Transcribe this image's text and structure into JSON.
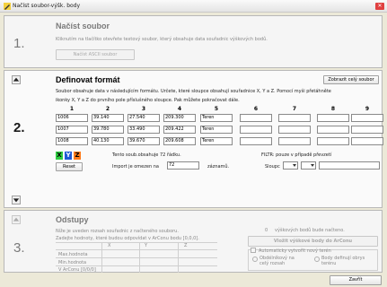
{
  "window": {
    "title": "Načíst soubor-výšk. body"
  },
  "step1": {
    "number": "1.",
    "heading": "Načíst soubor",
    "description": "Kliknutím na tlačítko otevřete textový soubor, který obsahuje data souřadnic výškových bodů.",
    "button": "Načíst ASCII soubor"
  },
  "step2": {
    "number": "2.",
    "heading": "Definovat formát",
    "button_show_file": "Zobrazit celý soubor",
    "description_line1": "Soubor obsahuje data v následujícím formátu. Určete, které sloupce obsahují souřadnice X, Y a Z. Pomocí myši přetáhněte",
    "description_line2": "ikonky X, Y a Z do prvního pole příslušného sloupce. Pak můžete pokračovat dále.",
    "columns": [
      "1",
      "2",
      "3",
      "4",
      "5",
      "6",
      "7",
      "8",
      "9"
    ],
    "rows": [
      [
        "1006",
        "39.140",
        "27.540",
        "209.300",
        "Teren",
        "",
        "",
        "",
        ""
      ],
      [
        "1007",
        "39.780",
        "33.490",
        "209.422",
        "Teren",
        "",
        "",
        "",
        ""
      ],
      [
        "1008",
        "40.130",
        "39.670",
        "209.608",
        "Teren",
        "",
        "",
        "",
        ""
      ]
    ],
    "xyz": [
      "X",
      "Y",
      "Z"
    ],
    "reset_button": "Reset",
    "rows_info": "Tento soub.obsahuje 72 řádku.",
    "import_label": "Import je omezen na",
    "import_value": "72",
    "records_label": "záznamů.",
    "filter_label": "FILTR: pouze v případě převzetí",
    "column_label": "Sloupc"
  },
  "step3": {
    "number": "3.",
    "heading": "Odstupy",
    "description_line1": "Níže je uveden rozsah souřadnic z načteného souboru.",
    "description_line2": "Zadejte hodnoty, které budou odpovídat v ArConu bodu [0,0,0].",
    "col_x": "X",
    "col_y": "Y",
    "col_z": "Z",
    "row_max": "Max.hodnota",
    "row_min": "Min.hodnota",
    "row_arcon": "V ArConu  [0/0/0]",
    "count_value": "0",
    "count_label": "výškových bodů bude načteno.",
    "insert_button": "Vložit výškové body do ArConu",
    "auto_terrain_label": "Automaticky vytvořit nový terén",
    "radio_rect": "Obdélníkový na celý rozsah",
    "radio_points": "Body definují obrys terénu"
  },
  "footer": {
    "close_button": "Zavřít"
  },
  "colors": {
    "x": "#2ecc40",
    "y": "#1f5ad6",
    "z": "#ff7a1a",
    "close": "#e04040"
  },
  "icons": [
    "pencil-icon",
    "close-icon",
    "up-triangle-icon",
    "down-triangle-icon",
    "dropdown-arrow-icon"
  ]
}
